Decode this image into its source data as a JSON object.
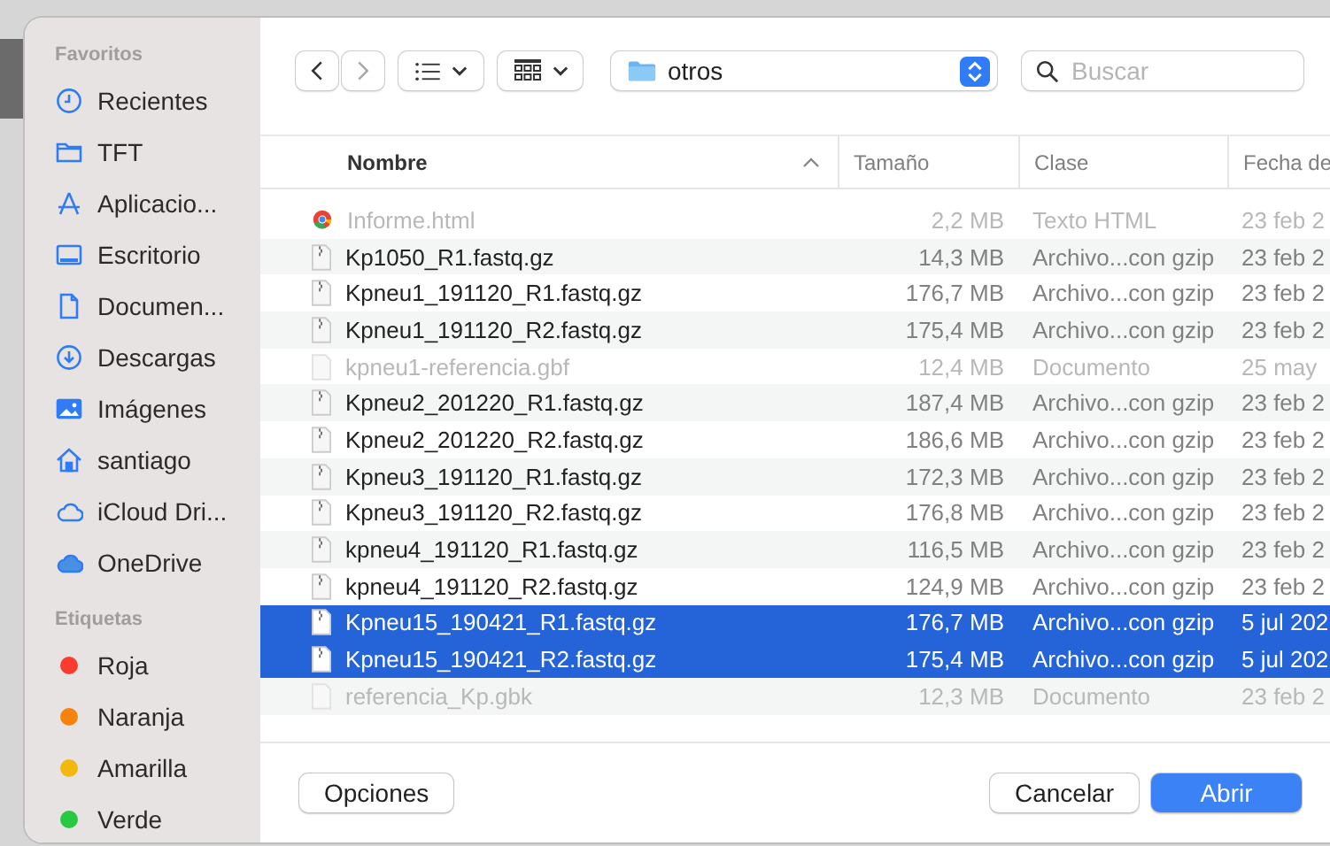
{
  "sidebar": {
    "sections": [
      {
        "title": "Favoritos",
        "items": [
          {
            "label": "Recientes"
          },
          {
            "label": "TFT"
          },
          {
            "label": "Aplicacio..."
          },
          {
            "label": "Escritorio"
          },
          {
            "label": "Documen..."
          },
          {
            "label": "Descargas"
          },
          {
            "label": "Imágenes"
          },
          {
            "label": "santiago"
          },
          {
            "label": "iCloud Dri..."
          },
          {
            "label": "OneDrive"
          }
        ]
      },
      {
        "title": "Etiquetas",
        "items": [
          {
            "label": "Roja",
            "color": "#fa3b30"
          },
          {
            "label": "Naranja",
            "color": "#f5830e"
          },
          {
            "label": "Amarilla",
            "color": "#f2b80c"
          },
          {
            "label": "Verde",
            "color": "#28c840"
          }
        ]
      }
    ]
  },
  "toolbar": {
    "location": "otros",
    "search": {
      "placeholder": "Buscar"
    }
  },
  "table": {
    "columns": [
      {
        "label": "Nombre",
        "sorted": true
      },
      {
        "label": "Tamaño",
        "sorted": false
      },
      {
        "label": "Clase",
        "sorted": false
      },
      {
        "label": "Fecha de",
        "sorted": false
      }
    ],
    "rows": [
      {
        "kind": "html",
        "name": "Informe.html",
        "size": "2,2 MB",
        "type": "Texto HTML",
        "date": "23 feb 2",
        "disabled": true,
        "selected": false
      },
      {
        "kind": "archive",
        "name": "Kp1050_R1.fastq.gz",
        "size": "14,3 MB",
        "type": "Archivo...con gzip",
        "date": "23 feb 2",
        "disabled": false,
        "selected": false
      },
      {
        "kind": "archive",
        "name": "Kpneu1_191120_R1.fastq.gz",
        "size": "176,7 MB",
        "type": "Archivo...con gzip",
        "date": "23 feb 2",
        "disabled": false,
        "selected": false
      },
      {
        "kind": "archive",
        "name": "Kpneu1_191120_R2.fastq.gz",
        "size": "175,4 MB",
        "type": "Archivo...con gzip",
        "date": "23 feb 2",
        "disabled": false,
        "selected": false
      },
      {
        "kind": "document",
        "name": "kpneu1-referencia.gbf",
        "size": "12,4 MB",
        "type": "Documento",
        "date": "25 may",
        "disabled": true,
        "selected": false
      },
      {
        "kind": "archive",
        "name": "Kpneu2_201220_R1.fastq.gz",
        "size": "187,4 MB",
        "type": "Archivo...con gzip",
        "date": "23 feb 2",
        "disabled": false,
        "selected": false
      },
      {
        "kind": "archive",
        "name": "Kpneu2_201220_R2.fastq.gz",
        "size": "186,6 MB",
        "type": "Archivo...con gzip",
        "date": "23 feb 2",
        "disabled": false,
        "selected": false
      },
      {
        "kind": "archive",
        "name": "Kpneu3_191120_R1.fastq.gz",
        "size": "172,3 MB",
        "type": "Archivo...con gzip",
        "date": "23 feb 2",
        "disabled": false,
        "selected": false
      },
      {
        "kind": "archive",
        "name": "Kpneu3_191120_R2.fastq.gz",
        "size": "176,8 MB",
        "type": "Archivo...con gzip",
        "date": "23 feb 2",
        "disabled": false,
        "selected": false
      },
      {
        "kind": "archive",
        "name": "kpneu4_191120_R1.fastq.gz",
        "size": "116,5 MB",
        "type": "Archivo...con gzip",
        "date": "23 feb 2",
        "disabled": false,
        "selected": false
      },
      {
        "kind": "archive",
        "name": "kpneu4_191120_R2.fastq.gz",
        "size": "124,9 MB",
        "type": "Archivo...con gzip",
        "date": "23 feb 2",
        "disabled": false,
        "selected": false
      },
      {
        "kind": "archive",
        "name": "Kpneu15_190421_R1.fastq.gz",
        "size": "176,7 MB",
        "type": "Archivo...con gzip",
        "date": "5 jul 202",
        "disabled": false,
        "selected": true
      },
      {
        "kind": "archive",
        "name": "Kpneu15_190421_R2.fastq.gz",
        "size": "175,4 MB",
        "type": "Archivo...con gzip",
        "date": "5 jul 202",
        "disabled": false,
        "selected": true
      },
      {
        "kind": "document",
        "name": "referencia_Kp.gbk",
        "size": "12,3 MB",
        "type": "Documento",
        "date": "23 feb 2",
        "disabled": true,
        "selected": false
      }
    ]
  },
  "buttons": [
    {
      "label": "Opciones",
      "kind": "normal"
    },
    {
      "label": "Cancelar",
      "kind": "normal"
    },
    {
      "label": "Abrir",
      "kind": "default"
    }
  ]
}
